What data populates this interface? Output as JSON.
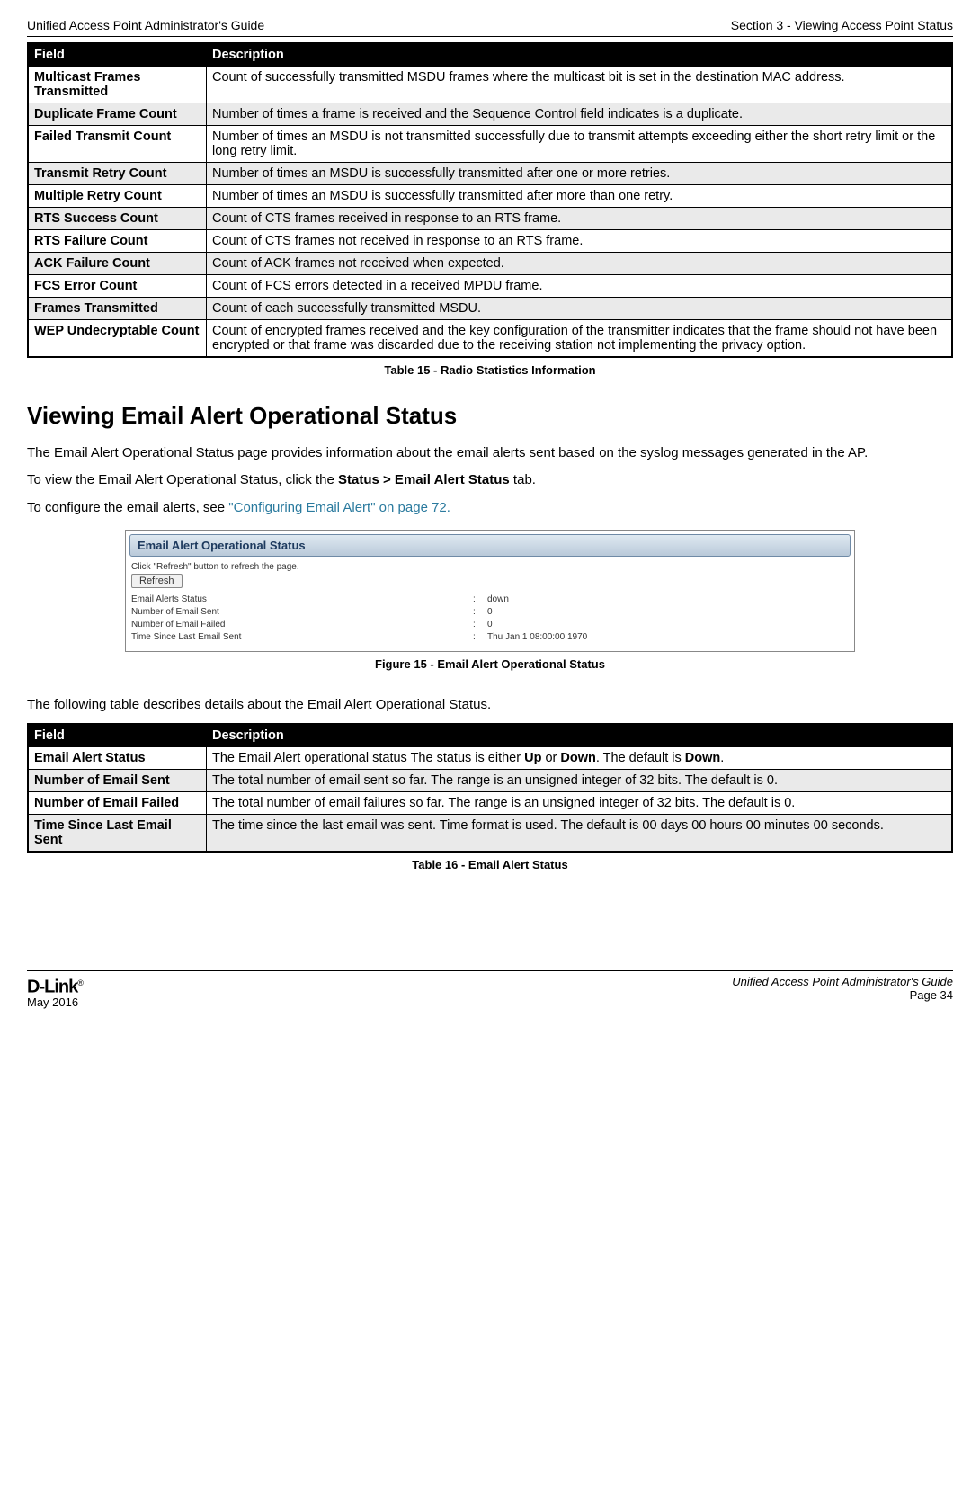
{
  "header": {
    "left": "Unified Access Point Administrator's Guide",
    "right": "Section 3 - Viewing Access Point Status"
  },
  "table1": {
    "head": {
      "field": "Field",
      "desc": "Description"
    },
    "rows": [
      {
        "f": "Multicast Frames Transmitted",
        "d": "Count of successfully transmitted MSDU frames where the multicast bit is set in the destination MAC address."
      },
      {
        "f": "Duplicate Frame Count",
        "d": "Number of times a frame is received and the Sequence Control field indicates is a duplicate."
      },
      {
        "f": "Failed Transmit Count",
        "d": "Number of times an MSDU is not transmitted successfully due to transmit attempts exceeding either the short retry limit or the long retry limit."
      },
      {
        "f": "Transmit Retry Count",
        "d": "Number of times an MSDU is successfully transmitted after one or more retries."
      },
      {
        "f": "Multiple Retry Count",
        "d": "Number of times an MSDU is successfully transmitted after more than one retry."
      },
      {
        "f": "RTS Success Count",
        "d": "Count of CTS frames received in response to an RTS frame."
      },
      {
        "f": "RTS Failure Count",
        "d": "Count of CTS frames not received in response to an RTS frame."
      },
      {
        "f": "ACK Failure Count",
        "d": "Count of ACK frames not received when expected."
      },
      {
        "f": "FCS Error Count",
        "d": "Count of FCS errors detected in a received MPDU frame."
      },
      {
        "f": "Frames Transmitted",
        "d": "Count of each successfully transmitted MSDU."
      },
      {
        "f": "WEP Undecryptable Count",
        "d": "Count of encrypted frames received and the key configuration of the transmitter indicates that the frame should not have been encrypted or that frame was discarded due to the receiving station not implementing the privacy option."
      }
    ],
    "caption": "Table 15 - Radio Statistics Information"
  },
  "section": {
    "title": "Viewing Email Alert Operational Status",
    "p1": "The Email Alert Operational Status page provides information about the email alerts sent based on the syslog messages generated in the AP.",
    "p2a": "To view the Email Alert Operational Status, click the ",
    "p2b": "Status > Email Alert Status",
    "p2c": " tab.",
    "p3a": "To configure the email alerts, see ",
    "p3link": "\"Configuring Email Alert\" on page 72.",
    "figcaption": "Figure 15 - Email Alert Operational Status",
    "p4": "The following table describes details about the Email Alert Operational Status."
  },
  "screenshot": {
    "panel_title": "Email Alert Operational Status",
    "hint": "Click \"Refresh\" button to refresh the page.",
    "refresh": "Refresh",
    "rows": [
      {
        "label": "Email Alerts Status",
        "value": "down"
      },
      {
        "label": "Number of Email Sent",
        "value": "0"
      },
      {
        "label": "Number of Email Failed",
        "value": "0"
      },
      {
        "label": "Time Since Last Email Sent",
        "value": "Thu Jan 1 08:00:00 1970"
      }
    ]
  },
  "table2": {
    "head": {
      "field": "Field",
      "desc": "Description"
    },
    "rows": [
      {
        "f": "Email Alert Status",
        "d_pre": "The Email Alert operational status The status is either ",
        "d_b1": "Up",
        "d_mid": " or ",
        "d_b2": "Down",
        "d_mid2": ". The default is ",
        "d_b3": "Down",
        "d_post": "."
      },
      {
        "f": "Number of Email Sent",
        "d": "The total number of email sent so far. The range is an unsigned integer of 32 bits. The default is 0."
      },
      {
        "f": "Number of Email Failed",
        "d": "The total number of email failures so far. The range is an unsigned integer of 32 bits. The default is 0."
      },
      {
        "f": "Time Since Last Email Sent",
        "d": "The time since the last email was sent. Time format is used. The default is 00 days 00 hours 00 minutes 00 seconds."
      }
    ],
    "caption": "Table 16 - Email Alert Status"
  },
  "footer": {
    "logo": "D-Link",
    "reg": "®",
    "date": "May 2016",
    "guide": "Unified Access Point Administrator's Guide",
    "page": "Page 34"
  }
}
